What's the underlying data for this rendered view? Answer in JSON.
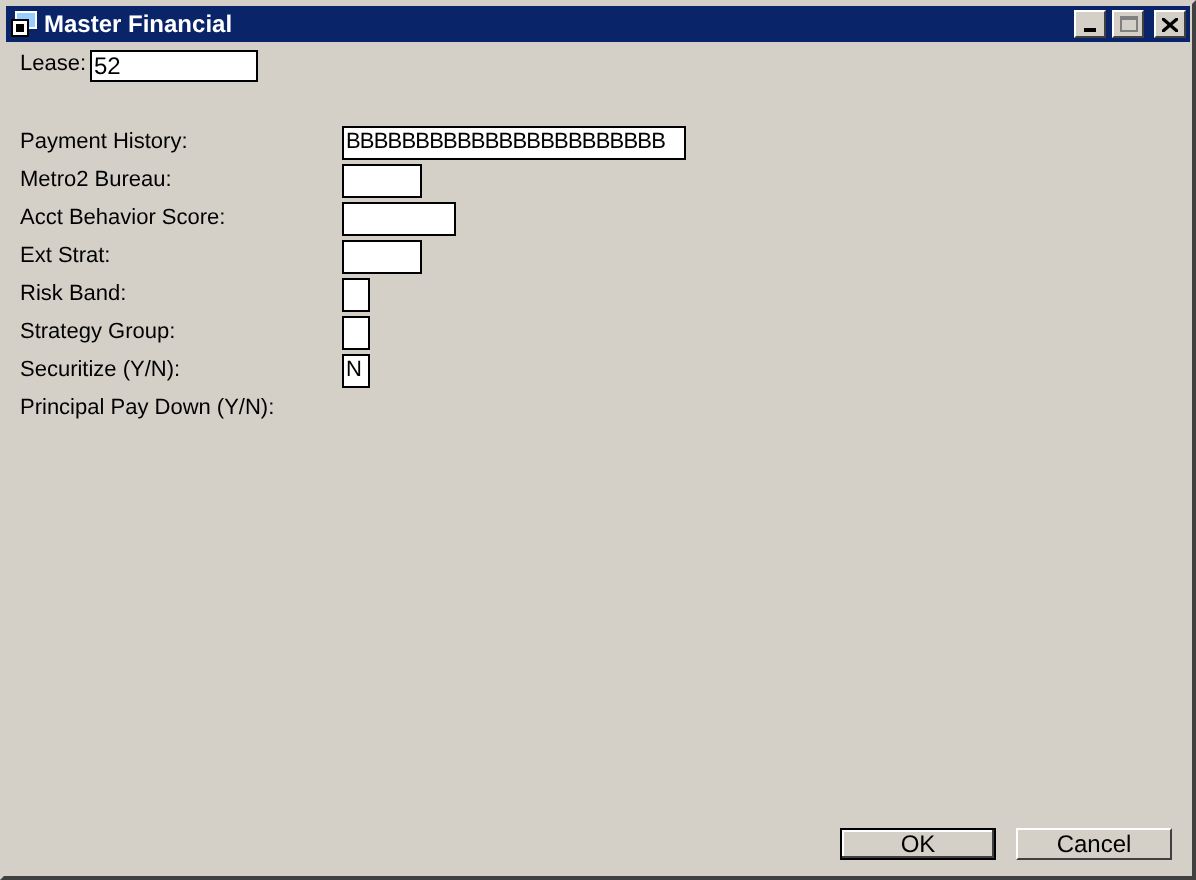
{
  "window": {
    "title": "Master Financial",
    "maximize_disabled": true
  },
  "lease": {
    "label": "Lease:",
    "value": "52"
  },
  "fields": [
    {
      "label": "Payment History:",
      "kind": "wide",
      "value": "BBBBBBBBBBBBBBBBBBBBBBB"
    },
    {
      "label": "Metro2 Bureau:",
      "kind": "medium"
    },
    {
      "label": "Acct Behavior Score:",
      "kind": "large"
    },
    {
      "label": "Ext Strat:",
      "kind": "medium"
    },
    {
      "label": "Risk Band:",
      "kind": "small"
    },
    {
      "label": "Strategy Group:",
      "kind": "small"
    },
    {
      "label": "Securitize (Y/N):",
      "kind": "small",
      "value": "N"
    },
    {
      "label": "Principal Pay Down (Y/N):",
      "kind": "none"
    }
  ],
  "buttons": [
    {
      "label": "OK",
      "default": true
    },
    {
      "label": "Cancel",
      "default": false
    }
  ]
}
